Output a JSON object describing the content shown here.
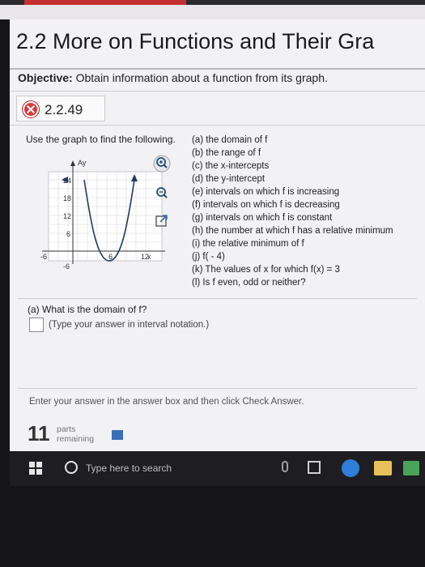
{
  "header": {
    "title": "2.2 More on Functions and Their Gra"
  },
  "objective": {
    "label": "Objective:",
    "text": "Obtain information about a function from its graph."
  },
  "problem": {
    "number": "2.2.49"
  },
  "instruction": "Use the graph to find the following.",
  "graph": {
    "y_label": "Ay",
    "x_label": "x",
    "y_ticks": [
      "24",
      "18",
      "12",
      "6",
      "-6"
    ],
    "x_ticks": [
      "-6",
      "6",
      "12"
    ]
  },
  "questions": [
    "(a) the domain of f",
    "(b) the range of f",
    "(c) the x-intercepts",
    "(d) the y-intercept",
    "(e) intervals on which f is increasing",
    "(f) intervals on which f is decreasing",
    "(g) intervals on which f is constant",
    "(h) the number at which f has a relative minimum",
    "(i) the relative minimum of f",
    "(j) f( - 4)",
    "(k) The values of x for which f(x) = 3",
    "(l) Is f even, odd or neither?"
  ],
  "current_question": "(a) What is the domain of f?",
  "answer": {
    "hint": "(Type your answer in interval notation.)",
    "value": ""
  },
  "footer": {
    "instruction": "Enter your answer in the answer box and then click Check Answer.",
    "parts_count": "11",
    "parts_line1": "parts",
    "parts_line2": "remaining"
  },
  "taskbar": {
    "search_placeholder": "Type here to search"
  },
  "colors": {
    "error_red": "#d83b3b",
    "accent_blue": "#3a6fb5",
    "curve_blue": "#1f3a66"
  }
}
